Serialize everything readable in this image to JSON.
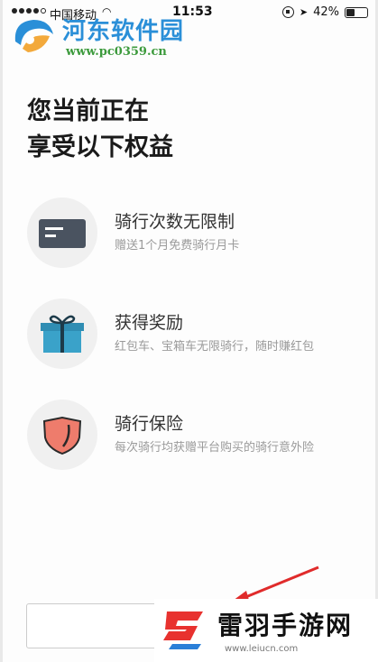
{
  "status_bar": {
    "carrier": "中国移动",
    "wifi_icon": "wifi-icon",
    "time": "11:53",
    "battery_percent": "42%",
    "battery_level": 0.42
  },
  "watermark_top": {
    "name": "河东软件园",
    "url": "www.pc0359.cn"
  },
  "heading": {
    "line1": "您当前正在",
    "line2": "享受以下权益"
  },
  "benefits": [
    {
      "icon": "card-icon",
      "title": "骑行次数无限制",
      "desc": "赠送1个月免费骑行月卡"
    },
    {
      "icon": "gift-icon",
      "title": "获得奖励",
      "desc": "红包车、宝箱车无限骑行，随时赚红包"
    },
    {
      "icon": "shield-icon",
      "title": "骑行保险",
      "desc": "每次骑行均获赠平台购买的骑行意外险"
    }
  ],
  "watermark_bottom": {
    "name": "雷羽手游网",
    "url": "www.leiucn.com"
  },
  "colors": {
    "card": "#4a5360",
    "gift": "#3aa2c9",
    "shield": "#ee7c6c",
    "brand_blue": "#2a8fd8",
    "arrow_red": "#e02b2b"
  }
}
